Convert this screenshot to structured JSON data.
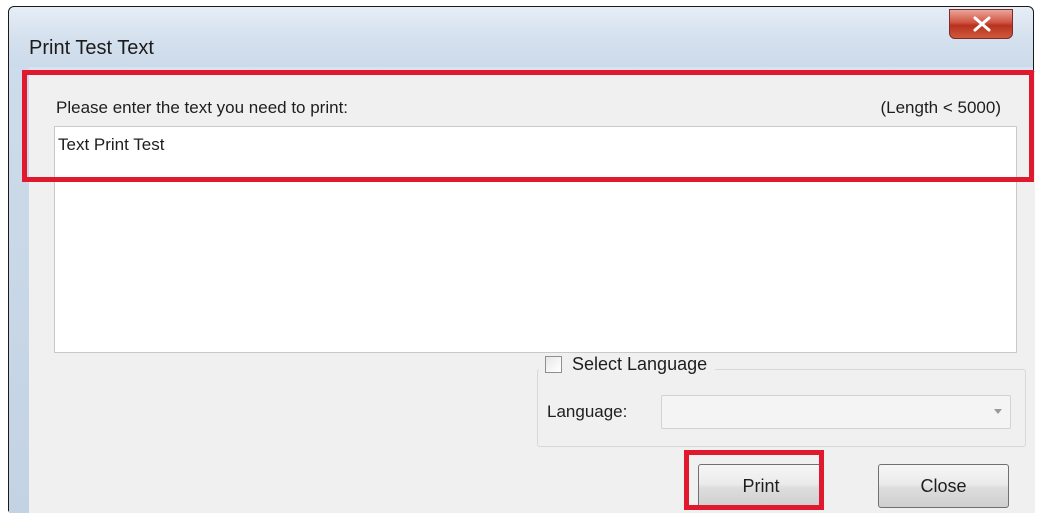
{
  "window": {
    "title": "Print Test Text",
    "close_icon": "close-icon"
  },
  "input_section": {
    "prompt": "Please enter the text you need to print:",
    "length_hint": "(Length < 5000)",
    "text_value": "Text Print Test"
  },
  "language_group": {
    "checkbox_label": "Select Language",
    "checkbox_checked": false,
    "language_label": "Language:",
    "language_value": ""
  },
  "buttons": {
    "print_label": "Print",
    "close_label": "Close"
  },
  "colors": {
    "highlight": "#e0192f",
    "close_button": "#c7422c"
  }
}
